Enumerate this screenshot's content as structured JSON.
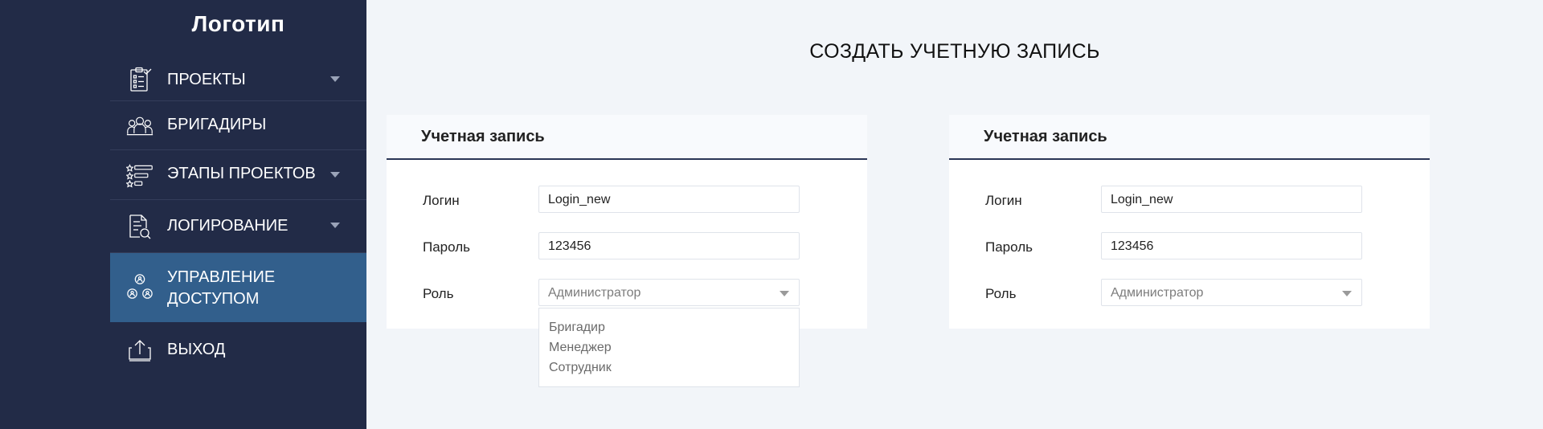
{
  "sidebar": {
    "logo": "Логотип",
    "items": [
      {
        "label": "Проекты",
        "icon": "clipboard-check-icon",
        "has_caret": true
      },
      {
        "label": "Бригадиры",
        "icon": "team-icon",
        "has_caret": false
      },
      {
        "label": "Этапы проектов",
        "icon": "stages-list-icon",
        "has_caret": true
      },
      {
        "label": "Логирование",
        "icon": "document-search-icon",
        "has_caret": true
      },
      {
        "label": "Управление доступом",
        "label_line1": "Управление",
        "label_line2": "доступом",
        "icon": "access-users-icon",
        "active": true
      },
      {
        "label": "Выход",
        "icon": "logout-upload-icon",
        "has_caret": false
      }
    ]
  },
  "main": {
    "title": "СОЗДАТЬ УЧЕТНУЮ ЗАПИСЬ",
    "cards": [
      {
        "header": "Учетная запись",
        "login_label": "Логин",
        "login_value": "Login_new",
        "password_label": "Пароль",
        "password_value": "123456",
        "role_label": "Роль",
        "role_value": "Администратор",
        "dropdown_open": true
      },
      {
        "header": "Учетная запись",
        "login_label": "Логин",
        "login_value": "Login_new",
        "password_label": "Пароль",
        "password_value": "123456",
        "role_label": "Роль",
        "role_value": "Администратор",
        "dropdown_open": false
      }
    ],
    "role_options": [
      "Бригадир",
      "Менеджер",
      "Сотрудник"
    ]
  },
  "colors": {
    "sidebar_bg": "#222b47",
    "active_item_bg": "#325f8c",
    "page_bg": "#f2f5f9",
    "card_header_border": "#2b3656"
  }
}
